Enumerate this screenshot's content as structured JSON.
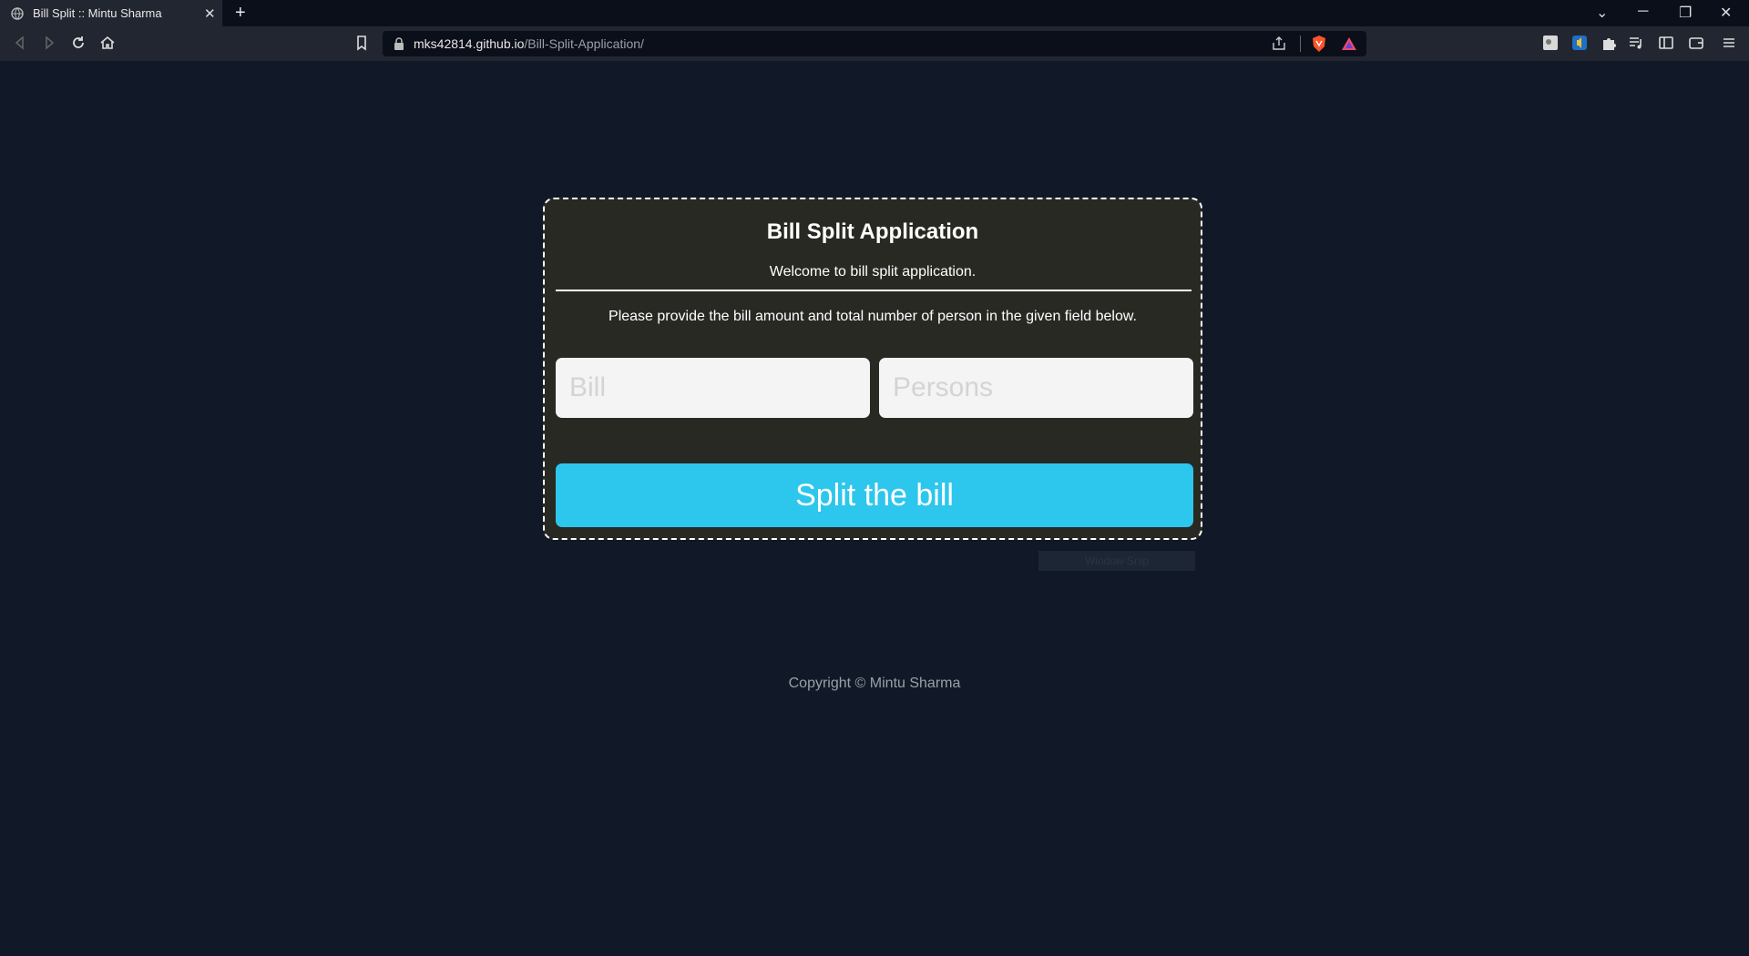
{
  "browser": {
    "tab_title": "Bill Split :: Mintu Sharma",
    "url_host": "mks42814.github.io",
    "url_path": "/Bill-Split-Application/"
  },
  "app": {
    "title": "Bill Split Application",
    "welcome": "Welcome to bill split application.",
    "instructions": "Please provide the bill amount and total number of person in the given field below.",
    "bill_placeholder": "Bill",
    "persons_placeholder": "Persons",
    "split_button": "Split the bill"
  },
  "overlay": {
    "snip_label": "Window Snip"
  },
  "footer": {
    "copyright": "Copyright © Mintu Sharma"
  },
  "colors": {
    "page_background": "#111827",
    "card_background": "#292924",
    "button": "#2dc6ec"
  }
}
